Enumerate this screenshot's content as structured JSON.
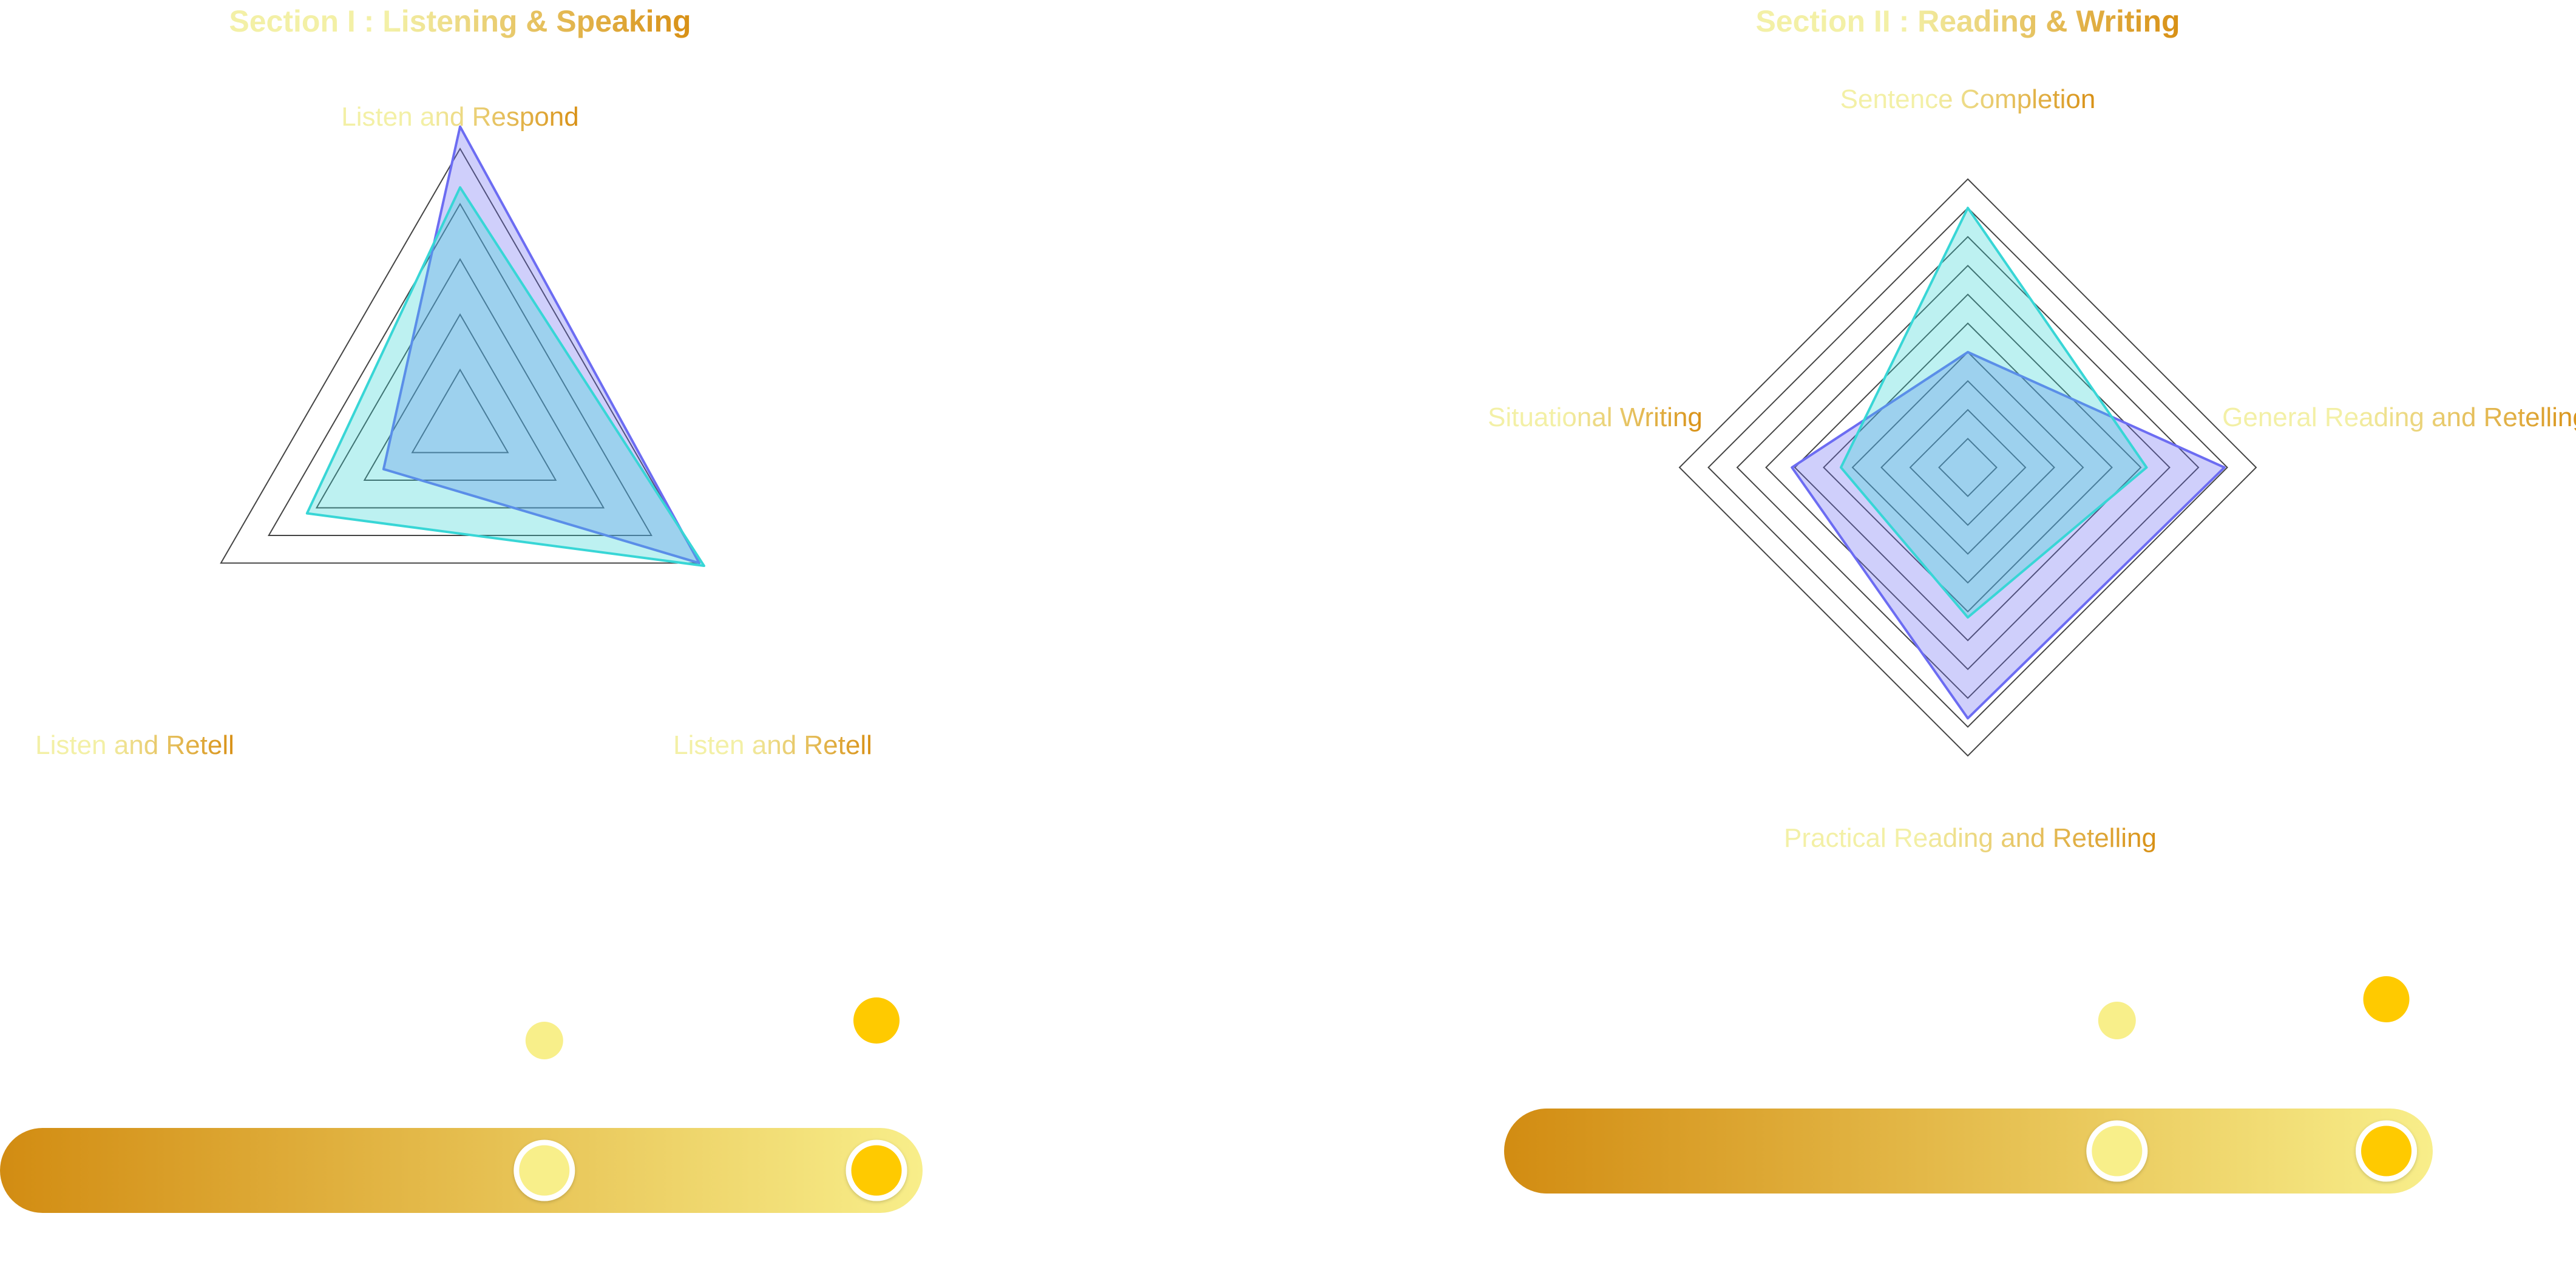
{
  "colors": {
    "text_gradient_start": "#f3f0a6",
    "text_gradient_end": "#d89015",
    "bar_gradient_start": "#d28c12",
    "bar_gradient_end": "#f8ee8a",
    "series_a": "#6c6cf2",
    "series_b": "#38d6d6",
    "grid": "#444444",
    "knob_light": "#f8ef8a",
    "knob_dark": "#ffca00"
  },
  "chart_data": [
    {
      "type": "radar",
      "title": "Section I : Listening & Speaking",
      "axes": [
        "Listen and Respond",
        "Listen and Retell",
        "Listen and Retell"
      ],
      "rings": 5,
      "max": 5,
      "grid": true,
      "legend": "none",
      "series": [
        {
          "values": [
            5.4,
            5.0,
            1.6
          ],
          "color_key": "series_a"
        },
        {
          "values": [
            4.3,
            5.1,
            3.2
          ],
          "color_key": "series_b"
        }
      ],
      "range_control": {
        "start": 0.59,
        "end": 0.95
      }
    },
    {
      "type": "radar",
      "title": "Section II : Reading & Writing",
      "axes": [
        "Sentence Completion",
        "General Reading and Retelling",
        "Practical Reading and Retelling",
        "Situational Writing"
      ],
      "rings": 10,
      "max": 10,
      "grid": true,
      "legend": "none",
      "series": [
        {
          "values": [
            4.0,
            8.9,
            8.7,
            6.1
          ],
          "color_key": "series_a"
        },
        {
          "values": [
            9.0,
            6.2,
            5.2,
            4.4
          ],
          "color_key": "series_b"
        }
      ],
      "range_control": {
        "start": 0.66,
        "end": 0.95
      }
    }
  ]
}
